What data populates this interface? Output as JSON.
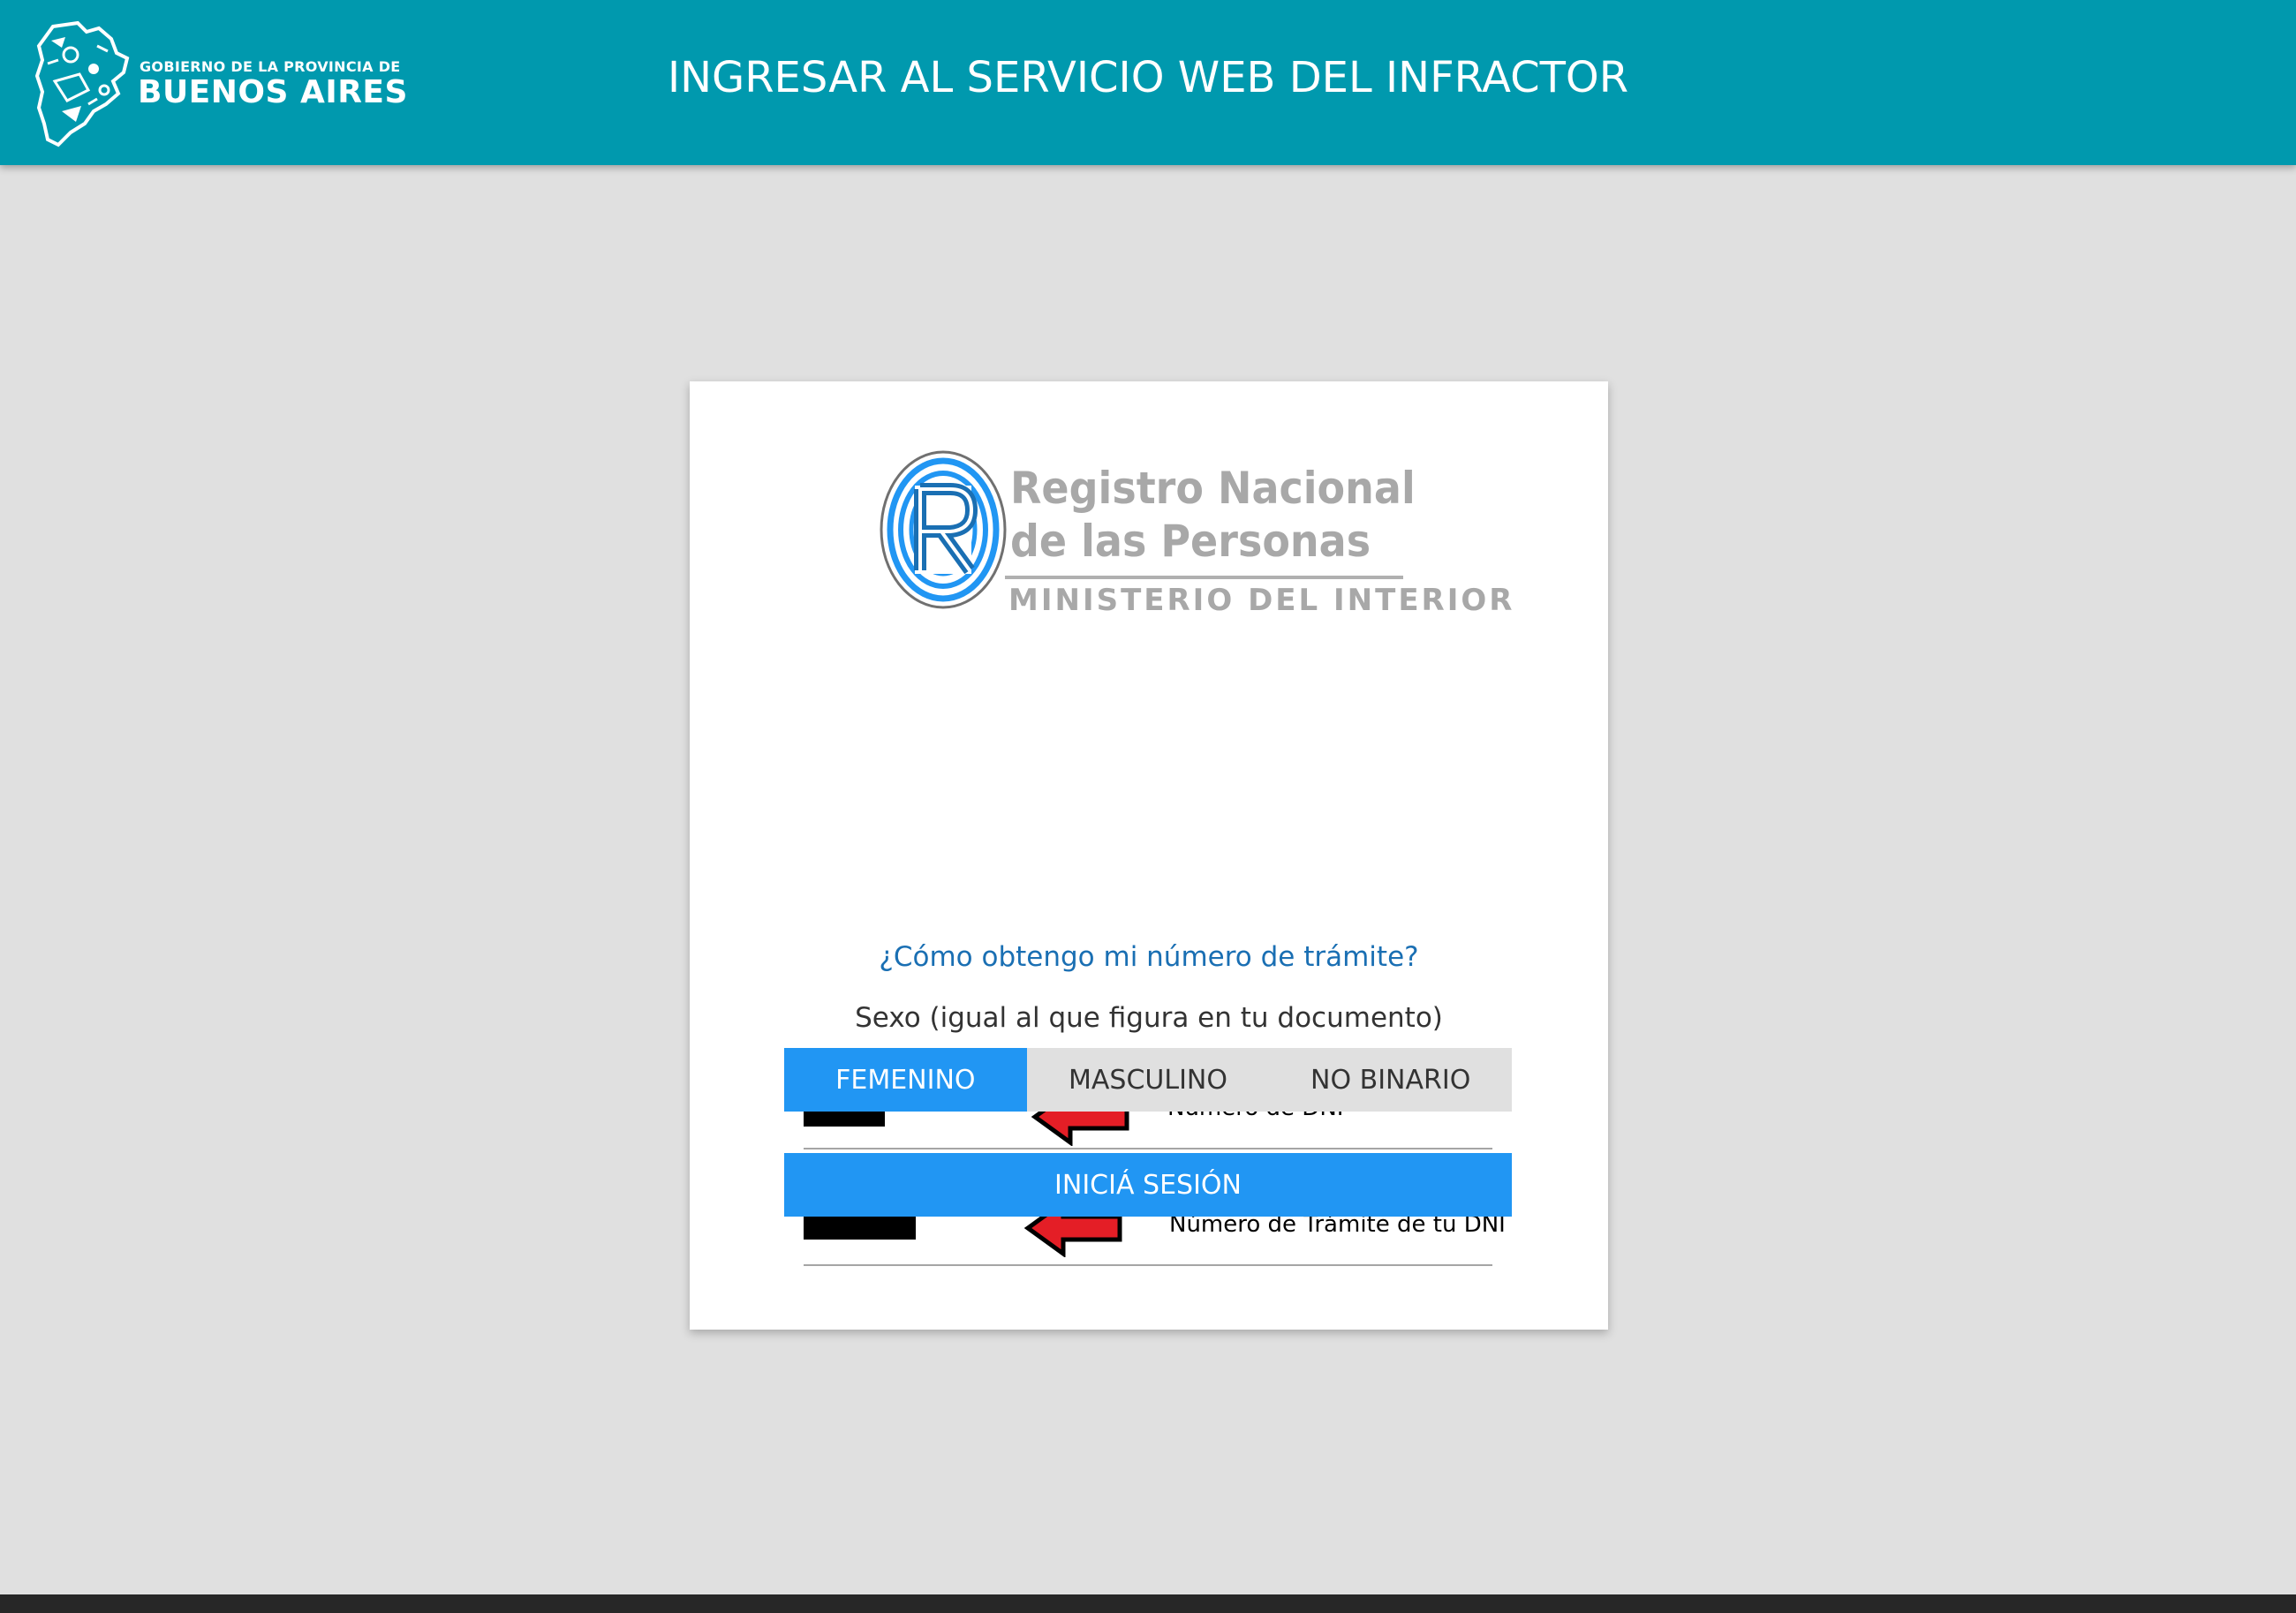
{
  "header": {
    "brand_top": "GOBIERNO DE LA PROVINCIA DE",
    "brand_main": "BUENOS AIRES",
    "brand_icon": "province-map-logo",
    "title": "INGRESAR AL SERVICIO WEB DEL INFRACTOR"
  },
  "logo": {
    "line1": "Registro Nacional",
    "line2": "de las Personas",
    "line3": "MINISTERIO DEL INTERIOR",
    "icon": "renaper-r-logo"
  },
  "fields": {
    "dni": {
      "annotation": "Número de DNI",
      "value": ""
    },
    "tramite": {
      "annotation": "Número de Trámite de tu DNI",
      "value": ""
    }
  },
  "help_link": "¿Cómo obtengo mi número de trámite?",
  "sexo": {
    "label": "Sexo (igual al que figura en tu documento)",
    "options": [
      "FEMENINO",
      "MASCULINO",
      "NO BINARIO"
    ],
    "selected": "FEMENINO"
  },
  "submit_label": "INICIÁ SESIÓN",
  "colors": {
    "header_bg": "#0099ae",
    "primary": "#2196f3",
    "link": "#1a6fb3",
    "page_bg": "#e0e0e0",
    "annotation_arrow": "#e41e26"
  }
}
